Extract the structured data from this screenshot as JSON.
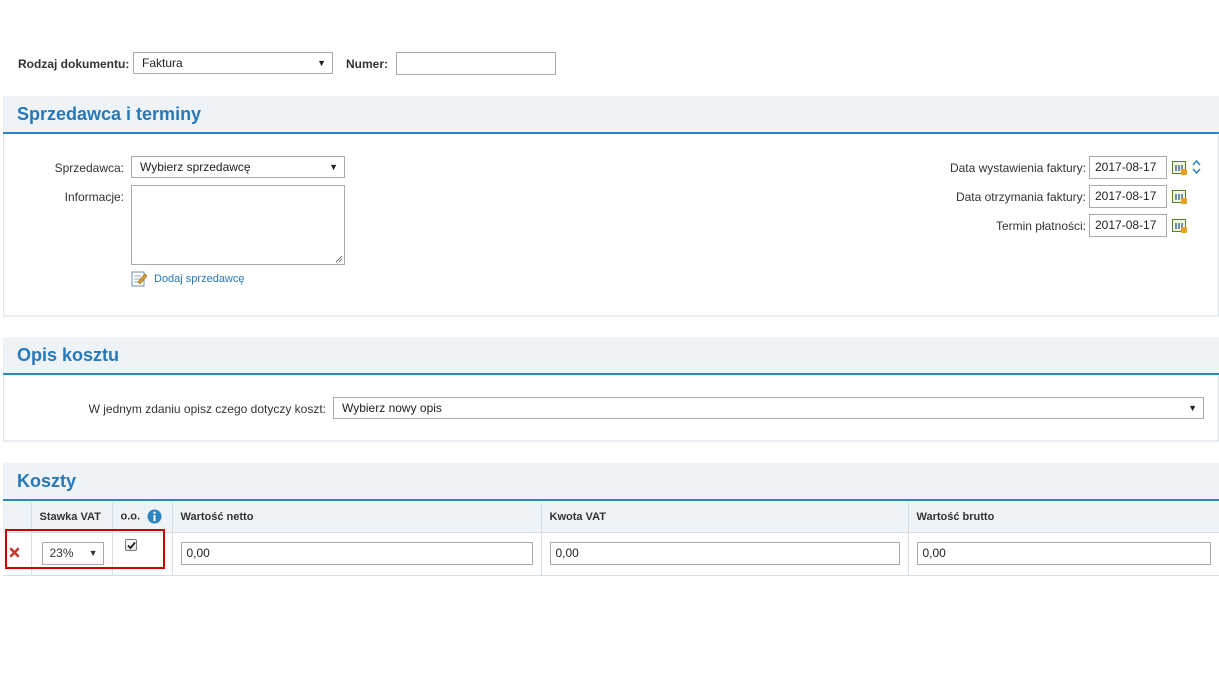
{
  "header": {
    "doc_type_label": "Rodzaj dokumentu:",
    "doc_type_value": "Faktura",
    "number_label": "Numer:",
    "number_value": ""
  },
  "seller_section": {
    "title": "Sprzedawca i terminy",
    "seller_label": "Sprzedawca:",
    "seller_value": "Wybierz sprzedawcę",
    "info_label": "Informacje:",
    "info_value": "",
    "add_seller_link": "Dodaj sprzedawcę",
    "issue_date_label": "Data wystawienia faktury:",
    "issue_date_value": "2017-08-17",
    "receipt_date_label": "Data otrzymania faktury:",
    "receipt_date_value": "2017-08-17",
    "payment_due_label": "Termin płatności:",
    "payment_due_value": "2017-08-17"
  },
  "cost_description": {
    "title": "Opis kosztu",
    "prompt_label": "W jednym zdaniu opisz czego dotyczy koszt:",
    "select_value": "Wybierz nowy opis"
  },
  "costs": {
    "title": "Koszty",
    "columns": {
      "vat_rate": "Stawka VAT",
      "oo": "o.o.",
      "net": "Wartość netto",
      "vat_amount": "Kwota VAT",
      "gross": "Wartość brutto"
    },
    "rows": [
      {
        "vat_rate": "23%",
        "oo_checked": true,
        "net": "0,00",
        "vat_amount": "0,00",
        "gross": "0,00"
      }
    ]
  },
  "colors": {
    "accent": "#2878b8",
    "highlight": "#cc0000",
    "delete": "#c0392b"
  }
}
